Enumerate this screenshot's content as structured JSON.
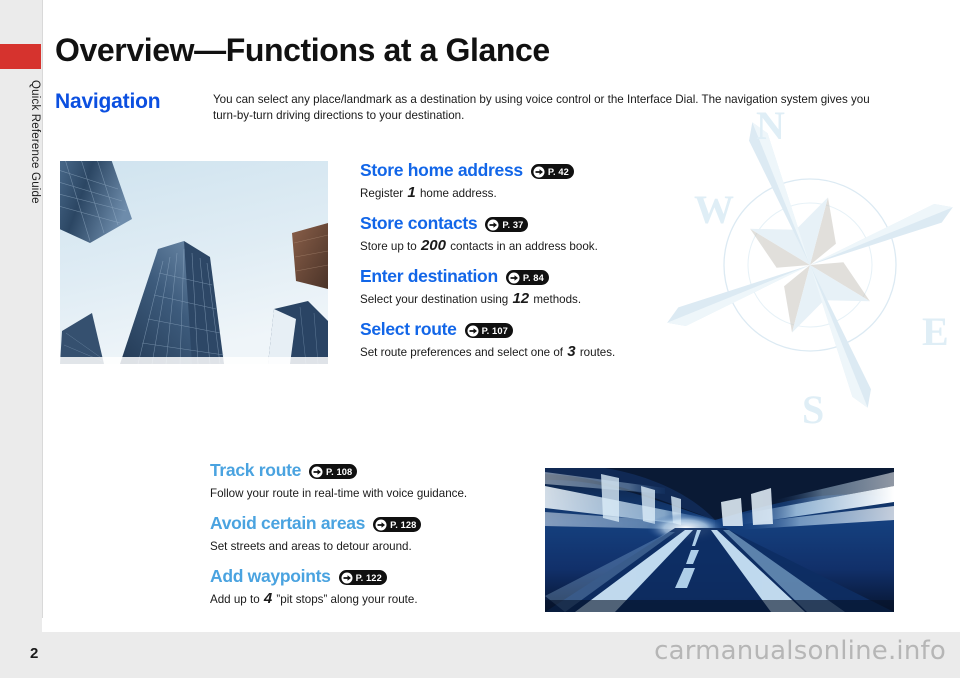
{
  "sidebar": {
    "label": "Quick Reference Guide",
    "accent_color": "#d6332e"
  },
  "header": {
    "title": "Overview—Functions at a Glance"
  },
  "section": {
    "title": "Navigation",
    "title_color": "#0b4fe0",
    "intro": "You can select any place/landmark as a destination by using voice control or the Interface Dial. The navigation system gives you turn-by-turn driving directions to your destination."
  },
  "compass": {
    "north": "N",
    "west": "W",
    "east": "E",
    "south": "S"
  },
  "photos": {
    "city": "skyscrapers-looking-up-photo",
    "tunnel": "motion-blur-tunnel-road-photo"
  },
  "features_top": {
    "color": "#1266e8",
    "items": [
      {
        "title": "Store home address",
        "page_ref": "P. 42",
        "desc_before": "Register ",
        "highlight": "1",
        "desc_after": " home address."
      },
      {
        "title": "Store contacts",
        "page_ref": "P. 37",
        "desc_before": "Store up to ",
        "highlight": "200",
        "desc_after": " contacts in an address book."
      },
      {
        "title": "Enter destination",
        "page_ref": "P. 84",
        "desc_before": "Select your destination using ",
        "highlight": "12",
        "desc_after": " methods."
      },
      {
        "title": "Select route",
        "page_ref": "P. 107",
        "desc_before": "Set route preferences and select one of ",
        "highlight": "3",
        "desc_after": " routes."
      }
    ]
  },
  "features_bottom": {
    "color": "#4aa3e0",
    "items": [
      {
        "title": "Track route",
        "page_ref": "P. 108",
        "desc_before": "Follow your route in real-time with voice guidance.",
        "highlight": "",
        "desc_after": ""
      },
      {
        "title": "Avoid certain areas",
        "page_ref": "P. 128",
        "desc_before": "Set streets and areas to detour around.",
        "highlight": "",
        "desc_after": ""
      },
      {
        "title": "Add waypoints",
        "page_ref": "P. 122",
        "desc_before": "Add up to ",
        "highlight": "4",
        "desc_after": " ”pit stops” along your route."
      }
    ]
  },
  "footer": {
    "page_number": "2",
    "watermark": "carmanualsonline.info"
  }
}
